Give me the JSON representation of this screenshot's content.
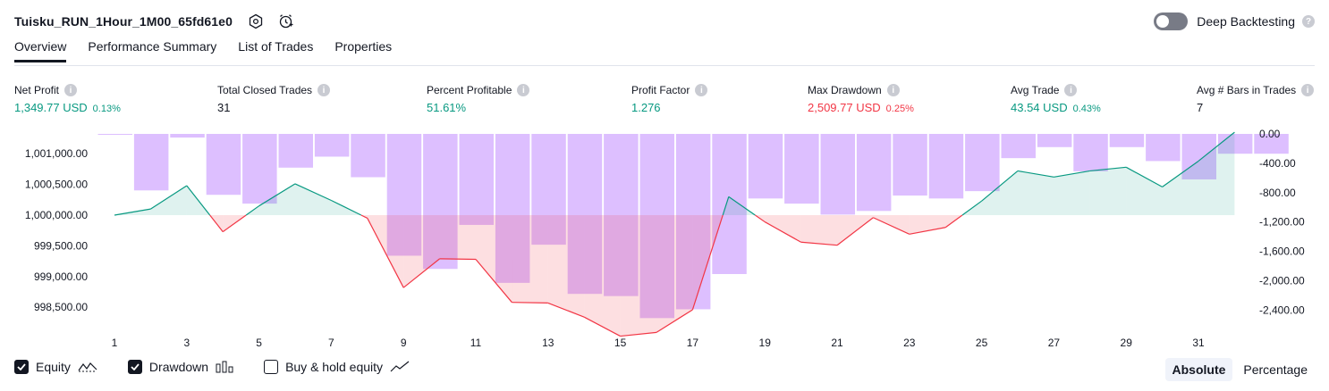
{
  "header": {
    "title": "Tuisku_RUN_1Hour_1M00_65fd61e0",
    "deep_backtesting": "Deep Backtesting"
  },
  "tabs": [
    "Overview",
    "Performance Summary",
    "List of Trades",
    "Properties"
  ],
  "metrics": {
    "net_profit": {
      "label": "Net Profit",
      "value": "1,349.77 USD",
      "pct": "0.13%"
    },
    "total_closed_trades": {
      "label": "Total Closed Trades",
      "value": "31"
    },
    "percent_profitable": {
      "label": "Percent Profitable",
      "value": "51.61%"
    },
    "profit_factor": {
      "label": "Profit Factor",
      "value": "1.276"
    },
    "max_drawdown": {
      "label": "Max Drawdown",
      "value": "2,509.77 USD",
      "pct": "0.25%"
    },
    "avg_trade": {
      "label": "Avg Trade",
      "value": "43.54 USD",
      "pct": "0.43%"
    },
    "avg_bars": {
      "label": "Avg # Bars in Trades",
      "value": "7"
    }
  },
  "legend": {
    "equity": "Equity",
    "drawdown": "Drawdown",
    "buy_hold": "Buy & hold equity"
  },
  "mode": {
    "absolute": "Absolute",
    "percentage": "Percentage"
  },
  "colors": {
    "positive": "#089981",
    "negative": "#f23645",
    "drawdown_bar": "#d9b8ff",
    "text": "#131722"
  },
  "chart_data": {
    "type": "line",
    "x_ticks": [
      "1",
      "3",
      "5",
      "7",
      "9",
      "11",
      "13",
      "15",
      "17",
      "19",
      "21",
      "23",
      "25",
      "27",
      "29",
      "31"
    ],
    "y_left_ticks": [
      "1,001,000.00",
      "1,000,500.00",
      "1,000,000.00",
      "999,500.00",
      "999,000.00",
      "998,500.00"
    ],
    "y_right_ticks": [
      "0.00",
      "-400.00",
      "-800.00",
      "-1,200.00",
      "-1,600.00",
      "-2,000.00",
      "-2,400.00"
    ],
    "equity_baseline": 1000000,
    "equity": {
      "x": [
        1,
        2,
        3,
        4,
        5,
        6,
        7,
        8,
        9,
        10,
        11,
        12,
        13,
        14,
        15,
        16,
        17,
        18,
        19,
        20,
        21,
        22,
        23,
        24,
        25,
        26,
        27,
        28,
        29,
        30,
        31,
        32,
        33
      ],
      "values": [
        1000000,
        1000100,
        1000480,
        999730,
        1000150,
        1000510,
        1000240,
        999950,
        998820,
        999290,
        999280,
        998580,
        998570,
        998340,
        998030,
        998090,
        998460,
        1000300,
        999890,
        999560,
        999510,
        999960,
        999690,
        999800,
        1000230,
        1000720,
        1000620,
        1000720,
        1000780,
        1000460,
        1000880,
        1001350,
        1001350
      ]
    },
    "drawdown": {
      "x": [
        1,
        2,
        3,
        4,
        5,
        6,
        7,
        8,
        9,
        10,
        11,
        12,
        13,
        14,
        15,
        16,
        17,
        18,
        19,
        20,
        21,
        22,
        23,
        24,
        25,
        26,
        27,
        28,
        29,
        30,
        31,
        32,
        33
      ],
      "values": [
        -10,
        -770,
        -50,
        -830,
        -950,
        -460,
        -310,
        -590,
        -1660,
        -1840,
        -1240,
        -2030,
        -1510,
        -2180,
        -2210,
        -2510,
        -2390,
        -1910,
        -880,
        -950,
        -1100,
        -1050,
        -840,
        -880,
        -780,
        -330,
        -180,
        -510,
        -180,
        -370,
        -620,
        -270,
        -270
      ]
    }
  }
}
